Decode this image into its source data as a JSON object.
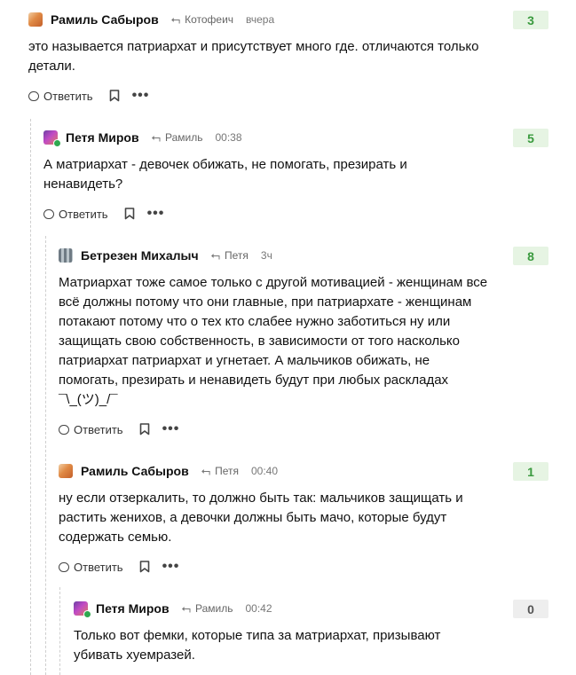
{
  "comments": [
    {
      "author": "Рамиль Сабыров",
      "reply_to": "Котофеич",
      "time": "вчера",
      "rating": "3",
      "text": "это называется патриархат и присутствует много где. отличаются только\nдетали.",
      "reply_label": "Ответить"
    },
    {
      "author": "Петя Миров",
      "reply_to": "Рамиль",
      "time": "00:38",
      "rating": "5",
      "text": "А матриархат - девочек обижать, не помогать, презирать и\nненавидеть?",
      "reply_label": "Ответить"
    },
    {
      "author": "Бетрезен Михалыч",
      "reply_to": "Петя",
      "time": "3ч",
      "rating": "8",
      "text": "Матриархат тоже самое только с другой мотивацией - женщинам все\nвсё должны потому что они главные, при патриархате - женщинам\nпотакают потому что о тех кто слабее нужно заботиться ну или\nзащищать свою собственность, в зависимости от того насколько\nпатриархат патриархат и угнетает. А мальчиков обижать, не\nпомогать, презирать и ненавидеть будут при любых раскладах\n¯\\_(ツ)_/¯",
      "reply_label": "Ответить"
    },
    {
      "author": "Рамиль Сабыров",
      "reply_to": "Петя",
      "time": "00:40",
      "rating": "1",
      "text": "ну если отзеркалить, то должно быть так: мальчиков защищать и\nрастить женихов, а девочки должны быть мачо, которые будут\nсодержать семью.",
      "reply_label": "Ответить"
    },
    {
      "author": "Петя Миров",
      "reply_to": "Рамиль",
      "time": "00:42",
      "rating": "0",
      "text": "Только вот фемки, которые типа за матриархат, призывают\nубивать хуемразей.",
      "reply_label": ""
    }
  ],
  "icons": {
    "reply_arrow": "reply-arrow-icon",
    "reply": "comment-bubble-icon",
    "bookmark": "bookmark-icon",
    "more": "more-dots-icon"
  },
  "colors": {
    "rating_positive_bg": "#e6f4e3",
    "rating_positive_text": "#3a9a3e",
    "rating_zero_bg": "#eeeeee",
    "online": "#2fa84f"
  }
}
